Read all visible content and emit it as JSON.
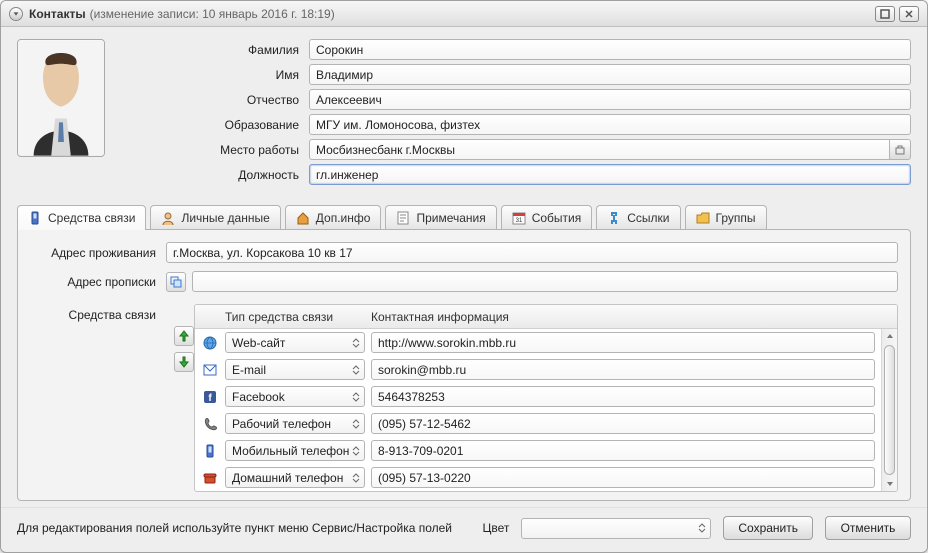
{
  "window": {
    "title": "Контакты",
    "subtitle": "(изменение записи: 10 январь 2016 г. 18:19)"
  },
  "fields": {
    "surname_label": "Фамилия",
    "surname": "Сорокин",
    "name_label": "Имя",
    "name": "Владимир",
    "patronymic_label": "Отчество",
    "patronymic": "Алексеевич",
    "education_label": "Образование",
    "education": "МГУ им. Ломоносова, физтех",
    "workplace_label": "Место работы",
    "workplace": "Мосбизнесбанк г.Москвы",
    "position_label": "Должность",
    "position": "гл.инженер"
  },
  "tabs": [
    {
      "label": "Средства связи"
    },
    {
      "label": "Личные данные"
    },
    {
      "label": "Доп.инфо"
    },
    {
      "label": "Примечания"
    },
    {
      "label": "События"
    },
    {
      "label": "Ссылки"
    },
    {
      "label": "Группы"
    }
  ],
  "panel": {
    "address_live_label": "Адрес проживания",
    "address_live": "г.Москва, ул. Корсакова 10 кв 17",
    "address_reg_label": "Адрес прописки",
    "address_reg": "",
    "comms_label": "Средства связи",
    "col_type": "Тип средства связи",
    "col_info": "Контактная информация"
  },
  "comms": [
    {
      "type": "Web-сайт",
      "value": "http://www.sorokin.mbb.ru"
    },
    {
      "type": "E-mail",
      "value": "sorokin@mbb.ru"
    },
    {
      "type": "Facebook",
      "value": "5464378253"
    },
    {
      "type": "Рабочий телефон",
      "value": "(095) 57-12-5462"
    },
    {
      "type": "Мобильный телефон",
      "value": "8-913-709-0201"
    },
    {
      "type": "Домашний телефон",
      "value": "(095) 57-13-0220"
    }
  ],
  "footer": {
    "hint": "Для редактирования полей используйте пункт меню Сервис/Настройка полей",
    "color_label": "Цвет",
    "save": "Сохранить",
    "cancel": "Отменить"
  }
}
